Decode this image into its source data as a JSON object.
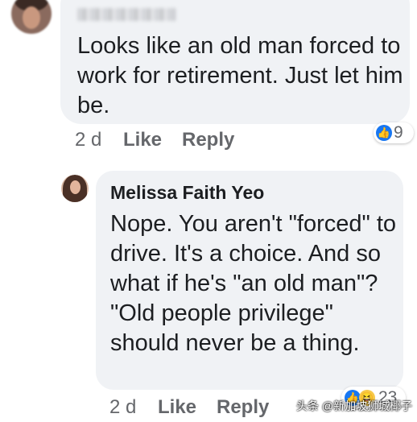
{
  "comment1": {
    "text": "Looks like an old man forced to work for retirement. Just let him be.",
    "time": "2 d",
    "like_label": "Like",
    "reply_label": "Reply",
    "reactions": {
      "icon": "like-icon",
      "count": "9"
    }
  },
  "comment2": {
    "author": "Melissa Faith Yeo",
    "text": "Nope. You aren't \"forced\" to drive. It's a choice. And so what if he's \"an old man\"? \"Old people privilege\" should never be a thing.",
    "time": "2 d",
    "like_label": "Like",
    "reply_label": "Reply",
    "reactions": {
      "icons": [
        "like-icon",
        "haha-icon"
      ],
      "count": "23"
    }
  },
  "watermark": "头条 @新加坡狮城椰子",
  "colors": {
    "bubble": "#f0f2f5",
    "meta": "#65676b",
    "like_blue": "#1877f2"
  }
}
